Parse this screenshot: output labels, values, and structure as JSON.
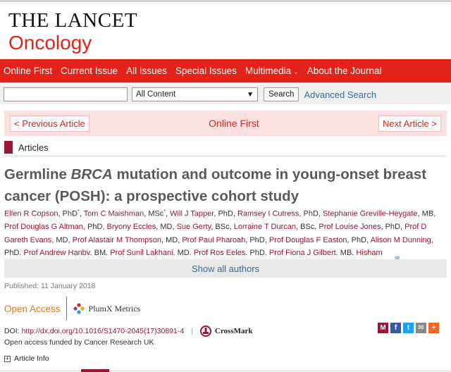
{
  "brand": {
    "line1": "THE LANCET",
    "line2": "Oncology"
  },
  "nav": {
    "items": [
      {
        "label": "Online First"
      },
      {
        "label": "Current Issue"
      },
      {
        "label": "All Issues"
      },
      {
        "label": "Special Issues"
      },
      {
        "label": "Multimedia"
      },
      {
        "label": "About the Journal"
      }
    ]
  },
  "search": {
    "input_value": "",
    "select_value": "All Content",
    "button_label": "Search",
    "advanced_label": "Advanced Search"
  },
  "article_nav": {
    "prev_label": "< Previous Article",
    "title": "Online First",
    "next_label": "Next Article >"
  },
  "section": {
    "label": "Articles"
  },
  "article": {
    "title_pre": "Germline ",
    "title_em": "BRCA",
    "title_post": " mutation and outcome in young-onset breast cancer (POSH): a prospective cohort study",
    "authors": [
      {
        "name": "Ellen R Copson",
        "suffix": ", PhD",
        "sup": "*"
      },
      {
        "name": "Tom C Maishman",
        "suffix": ", MSc",
        "sup": "*"
      },
      {
        "name": "Will J Tapper",
        "suffix": ", PhD"
      },
      {
        "name": "Ramsey I Cutress",
        "suffix": ", PhD"
      },
      {
        "name": "Stephanie Greville-Heygate",
        "suffix": ", MB"
      },
      {
        "name": "Prof Douglas G Altman",
        "suffix": ", PhD"
      },
      {
        "name": "Bryony Eccles",
        "suffix": ", MD"
      },
      {
        "name": "Sue Gerty",
        "suffix": ", BSc"
      },
      {
        "name": "Lorraine T Durcan",
        "suffix": ", BSc"
      },
      {
        "name": "Prof Louise Jones",
        "suffix": ", PhD"
      },
      {
        "name": "Prof D Gareth Evans",
        "suffix": ", MD"
      },
      {
        "name": "Prof Alastair M Thompson",
        "suffix": ", MD"
      },
      {
        "name": "Prof Paul Pharoah",
        "suffix": ", PhD"
      },
      {
        "name": "Prof Douglas F Easton",
        "suffix": ", PhD"
      },
      {
        "name": "Alison M Dunning",
        "suffix": ", PhD"
      },
      {
        "name": "Prof Andrew Hanby",
        "suffix": ", BM"
      },
      {
        "name": "Prof Sunil Lakhani",
        "suffix": ", MD"
      },
      {
        "name": "Prof Ros Eeles",
        "suffix": ", PhD"
      },
      {
        "name": "Prof Fiona J Gilbert",
        "suffix": ", MB"
      },
      {
        "name": "Hisham",
        "suffix": ""
      }
    ],
    "show_all_label": "Show all authors",
    "published": "Published: 11 January 2018",
    "open_access_label": "Open Access",
    "plumx_label": "PlumX Metrics",
    "doi_prefix": "DOI:",
    "doi_link": "http://dx.doi.org/10.1016/S1470-2045(17)30891-4",
    "doi_separator": "|",
    "crossmark_label": "CrossMark",
    "funded": "Open access funded by Cancer Research UK",
    "article_info_label": "Article Info"
  },
  "share": {
    "buttons": [
      {
        "icon": "mendeley-icon",
        "glyph": "M",
        "color": "#9b1530"
      },
      {
        "icon": "facebook-icon",
        "glyph": "f",
        "color": "#3b5998"
      },
      {
        "icon": "twitter-icon",
        "glyph": "t",
        "color": "#1da1f2"
      },
      {
        "icon": "email-icon",
        "glyph": "✉",
        "color": "#888888"
      },
      {
        "icon": "more-icon",
        "glyph": "+",
        "color": "#f26522"
      }
    ]
  },
  "colors": {
    "brand_red": "#e2231a",
    "author_link": "#9b1530",
    "link_blue": "#3a6a9a",
    "open_access": "#e07a1a"
  }
}
